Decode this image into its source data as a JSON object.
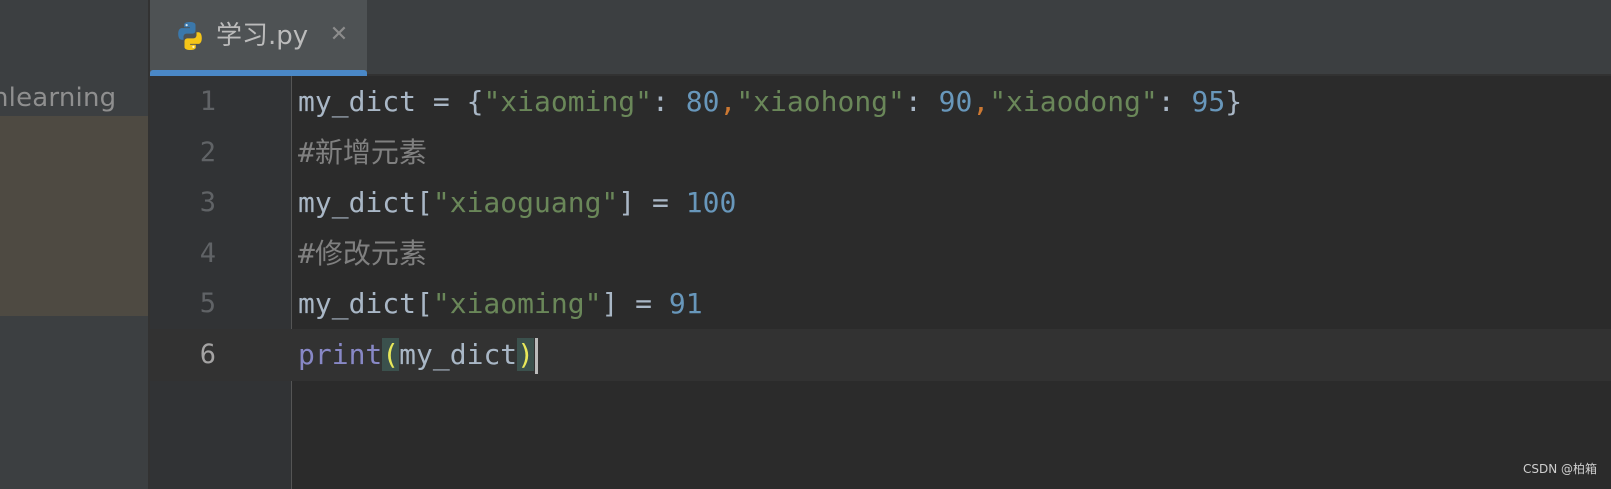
{
  "project_panel": {
    "label": "nlearning"
  },
  "tab": {
    "title": "学习.py",
    "icon": "python-file-icon",
    "close_icon": "close-icon"
  },
  "editor": {
    "current_line": 6,
    "lines": [
      {
        "number": "1",
        "tokens": [
          {
            "text": "my_dict = {",
            "kind": "plain"
          },
          {
            "text": "\"xiaoming\"",
            "kind": "str"
          },
          {
            "text": ": ",
            "kind": "plain"
          },
          {
            "text": "80",
            "kind": "num"
          },
          {
            "text": ",",
            "kind": "comma"
          },
          {
            "text": "\"xiaohong\"",
            "kind": "str"
          },
          {
            "text": ": ",
            "kind": "plain"
          },
          {
            "text": "90",
            "kind": "num"
          },
          {
            "text": ",",
            "kind": "comma"
          },
          {
            "text": "\"xiaodong\"",
            "kind": "str"
          },
          {
            "text": ": ",
            "kind": "plain"
          },
          {
            "text": "95",
            "kind": "num"
          },
          {
            "text": "}",
            "kind": "plain"
          }
        ]
      },
      {
        "number": "2",
        "tokens": [
          {
            "text": "#新增元素",
            "kind": "comment"
          }
        ]
      },
      {
        "number": "3",
        "tokens": [
          {
            "text": "my_dict[",
            "kind": "plain"
          },
          {
            "text": "\"xiaoguang\"",
            "kind": "str"
          },
          {
            "text": "] = ",
            "kind": "plain"
          },
          {
            "text": "100",
            "kind": "num"
          }
        ]
      },
      {
        "number": "4",
        "tokens": [
          {
            "text": "#修改元素",
            "kind": "comment"
          }
        ]
      },
      {
        "number": "5",
        "tokens": [
          {
            "text": "my_dict[",
            "kind": "plain"
          },
          {
            "text": "\"xiaoming\"",
            "kind": "str"
          },
          {
            "text": "] = ",
            "kind": "plain"
          },
          {
            "text": "91",
            "kind": "num"
          }
        ]
      },
      {
        "number": "6",
        "tokens": [
          {
            "text": "print",
            "kind": "builtin"
          },
          {
            "text": "(",
            "kind": "paren"
          },
          {
            "text": "my_dict",
            "kind": "plain"
          },
          {
            "text": ")",
            "kind": "paren"
          }
        ],
        "caret_after": true
      }
    ]
  },
  "watermark": "CSDN @柏箱",
  "colors": {
    "string": "#6a8759",
    "number": "#6897bb",
    "comma": "#cc7832",
    "comment": "#808080",
    "builtin": "#8888c6",
    "paren_highlight": "#e8e85a",
    "tab_underline": "#4a88c7"
  }
}
